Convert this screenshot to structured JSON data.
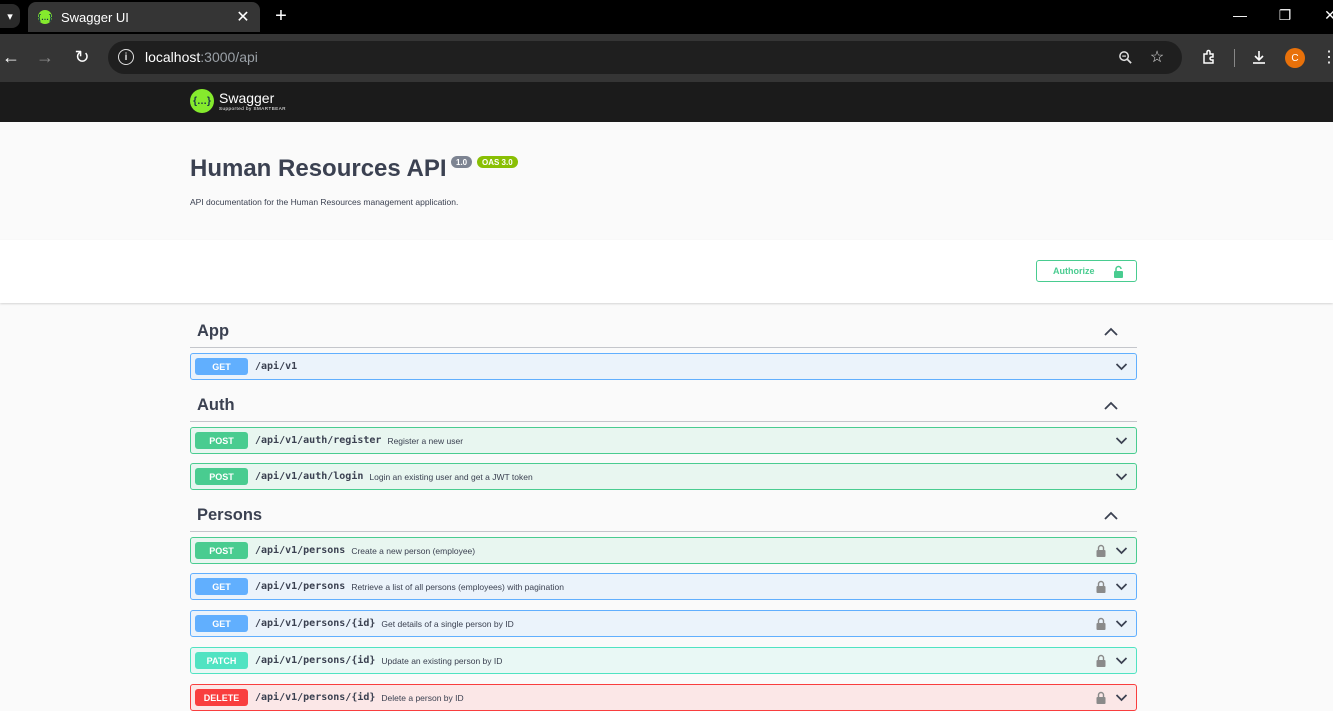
{
  "browser": {
    "tab_title": "Swagger UI",
    "url_host": "localhost",
    "url_rest": ":3000/api",
    "profile_initial": "C"
  },
  "swagger": {
    "logo_name": "Swagger",
    "logo_sub": "Supported by SMARTBEAR"
  },
  "info": {
    "title": "Human Resources API",
    "version": "1.0",
    "oas": "OAS 3.0",
    "description": "API documentation for the Human Resources management application."
  },
  "authorize_label": "Authorize",
  "tags": [
    {
      "name": "App"
    },
    {
      "name": "Auth"
    },
    {
      "name": "Persons"
    }
  ],
  "operations": [
    {
      "method": "GET",
      "path": "/api/v1",
      "summary": "",
      "locked": false
    },
    {
      "method": "POST",
      "path": "/api/v1/auth/register",
      "summary": "Register a new user",
      "locked": false
    },
    {
      "method": "POST",
      "path": "/api/v1/auth/login",
      "summary": "Login an existing user and get a JWT token",
      "locked": false
    },
    {
      "method": "POST",
      "path": "/api/v1/persons",
      "summary": "Create a new person (employee)",
      "locked": true
    },
    {
      "method": "GET",
      "path": "/api/v1/persons",
      "summary": "Retrieve a list of all persons (employees) with pagination",
      "locked": true
    },
    {
      "method": "GET",
      "path": "/api/v1/persons/{id}",
      "summary": "Get details of a single person by ID",
      "locked": true
    },
    {
      "method": "PATCH",
      "path": "/api/v1/persons/{id}",
      "summary": "Update an existing person by ID",
      "locked": true
    },
    {
      "method": "DELETE",
      "path": "/api/v1/persons/{id}",
      "summary": "Delete a person by ID",
      "locked": true
    }
  ]
}
